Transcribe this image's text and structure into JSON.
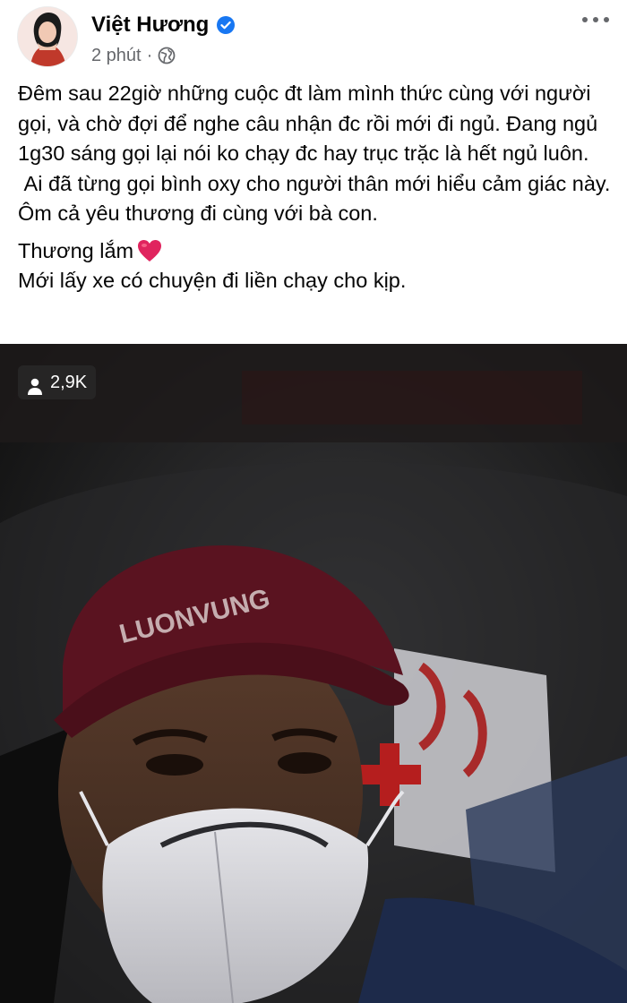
{
  "post": {
    "author": "Việt Hương",
    "time": "2 phút",
    "separator": "·",
    "icons": {
      "verified": "verified-badge-icon",
      "audience": "globe-icon",
      "more": "more-options-icon",
      "heart": "red-heart-emoji"
    },
    "text": {
      "paragraph1": "Đêm sau 22giờ những cuộc đt làm mình thức cùng với người gọi, và chờ đợi để nghe câu nhận đc rồi mới đi ngủ. Đang ngủ 1g30 sáng gọi lại nói ko chạy đc hay trục trặc là hết ngủ luôn.",
      "paragraph2": " Ai đã từng gọi bình oxy cho người thân mới hiểu cảm giác này. Ôm cả yêu thương đi cùng với bà con.",
      "line3": "Thương lắm",
      "line4": "Mới lấy xe có chuyện đi liền chạy cho kịp."
    },
    "media": {
      "views": "2,9K",
      "views_icon": "person-icon"
    }
  },
  "colors": {
    "verified": "#1877f2",
    "secondary_text": "#65676b",
    "heart": "#e0245e"
  }
}
